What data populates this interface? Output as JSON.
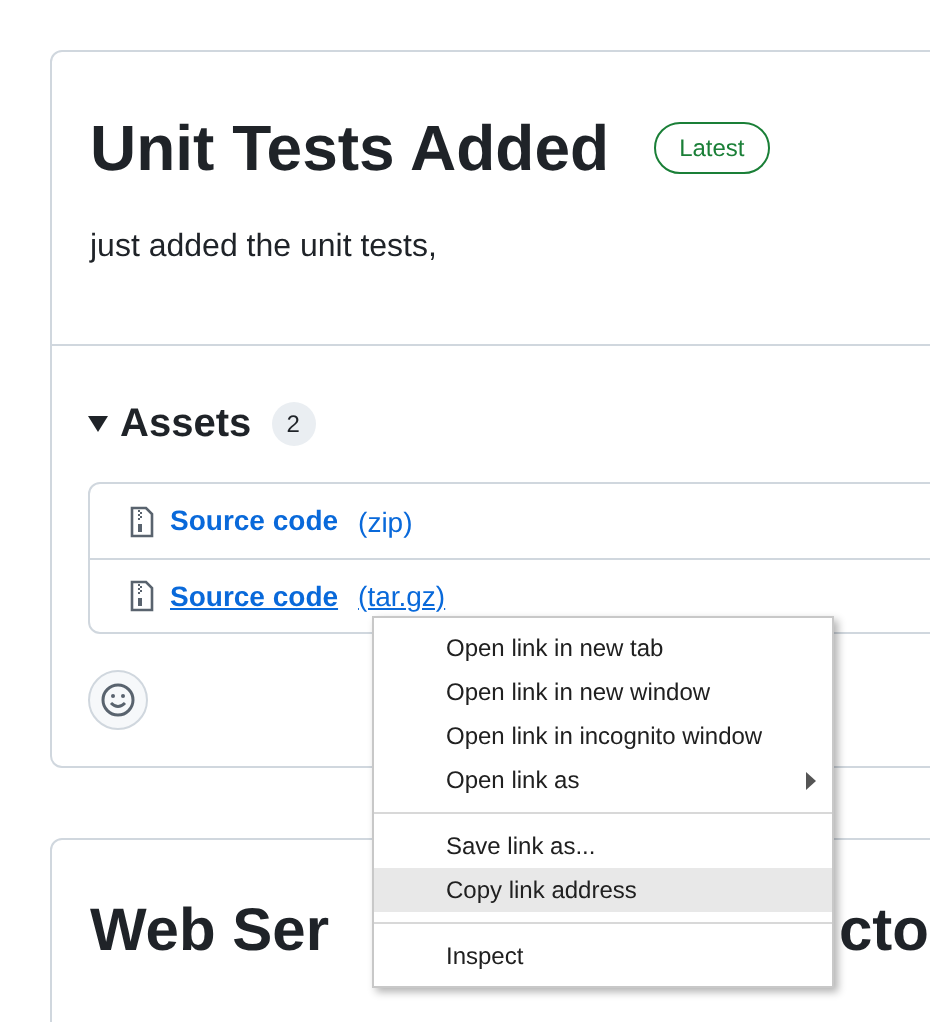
{
  "release": {
    "title": "Unit Tests Added",
    "badge": "Latest",
    "description": "just added the unit tests,",
    "assets": {
      "expanded": true,
      "label": "Assets",
      "count": "2",
      "items": [
        {
          "name": "Source code",
          "format": "(zip)",
          "hovered": false
        },
        {
          "name": "Source code",
          "format": "(tar.gz)",
          "hovered": true
        }
      ]
    }
  },
  "next_release": {
    "title_parts": [
      "Web Ser",
      "cto"
    ]
  },
  "context_menu": {
    "groups": [
      [
        {
          "label": "Open link in new tab",
          "submenu": false,
          "selected": false
        },
        {
          "label": "Open link in new window",
          "submenu": false,
          "selected": false
        },
        {
          "label": "Open link in incognito window",
          "submenu": false,
          "selected": false
        },
        {
          "label": "Open link as",
          "submenu": true,
          "selected": false
        }
      ],
      [
        {
          "label": "Save link as...",
          "submenu": false,
          "selected": false
        },
        {
          "label": "Copy link address",
          "submenu": false,
          "selected": true
        }
      ],
      [
        {
          "label": "Inspect",
          "submenu": false,
          "selected": false
        }
      ]
    ]
  }
}
